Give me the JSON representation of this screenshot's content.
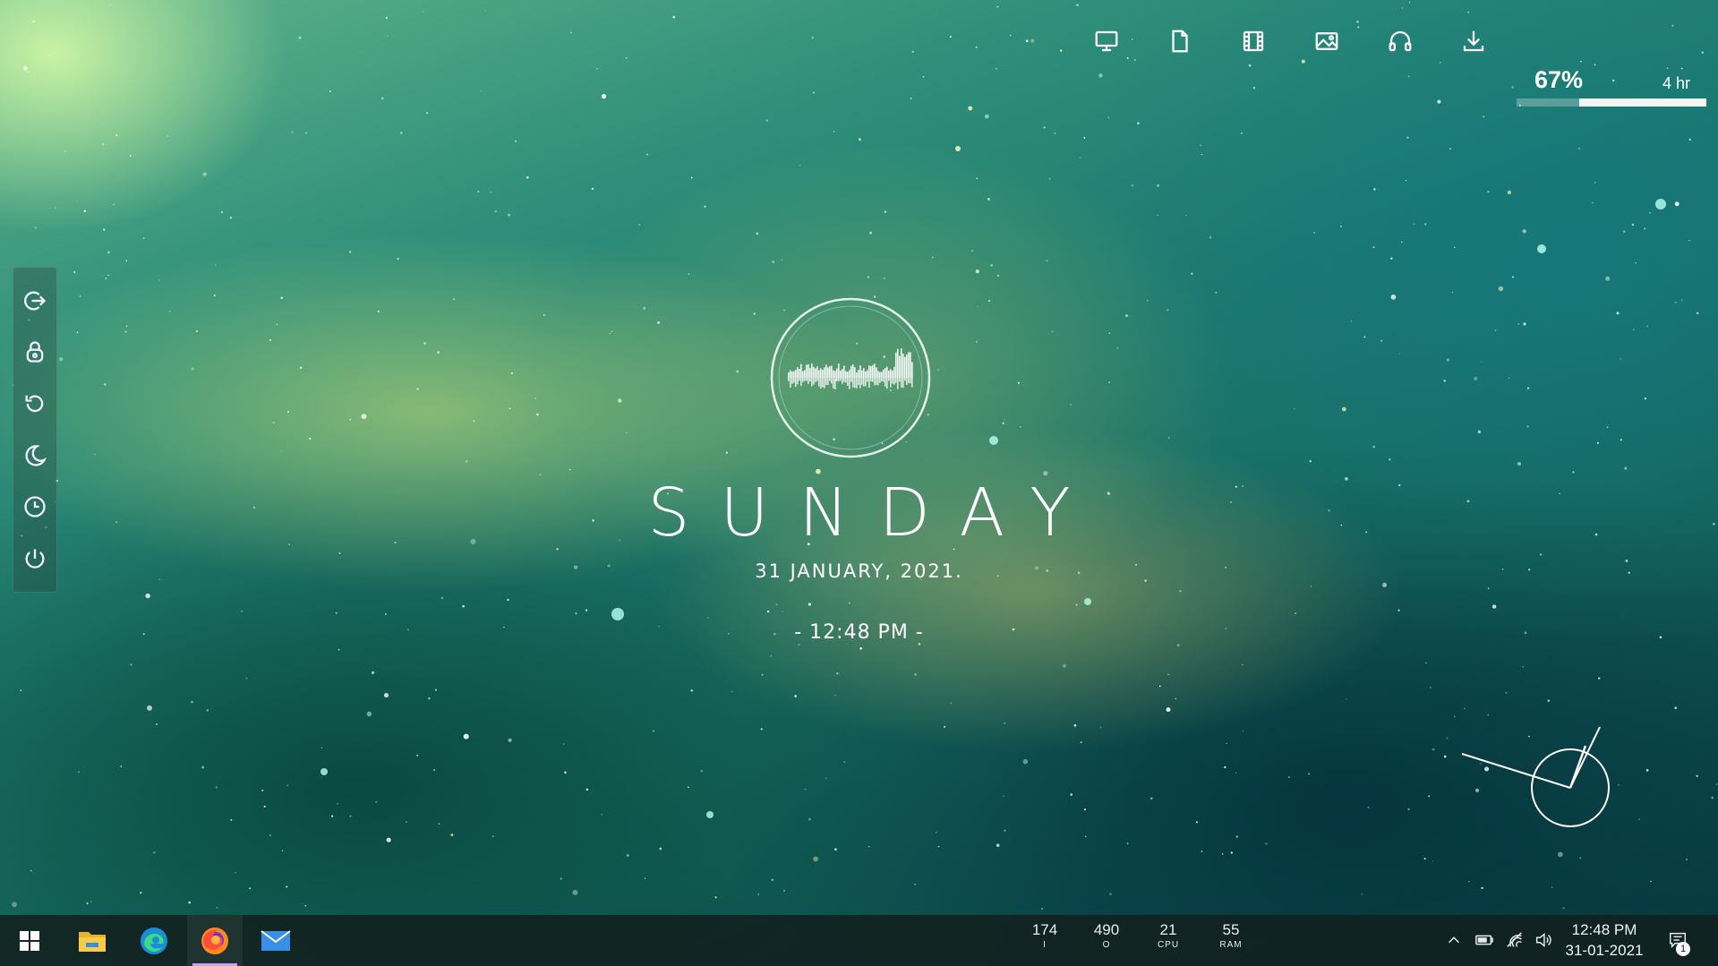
{
  "top_icons": [
    {
      "name": "monitor-icon"
    },
    {
      "name": "document-icon"
    },
    {
      "name": "film-icon"
    },
    {
      "name": "image-icon"
    },
    {
      "name": "headphones-icon"
    },
    {
      "name": "download-icon"
    }
  ],
  "battery": {
    "percent_text": "67%",
    "time_text": "4 hr",
    "level": 0.67
  },
  "power_panel": [
    {
      "name": "sign-out-icon"
    },
    {
      "name": "lock-icon"
    },
    {
      "name": "restart-icon"
    },
    {
      "name": "sleep-icon"
    },
    {
      "name": "hibernate-clock-icon"
    },
    {
      "name": "power-icon"
    }
  ],
  "center": {
    "day": "SUNDAY",
    "date": "31 JANUARY, 2021.",
    "time": "- 12:48 PM -"
  },
  "taskbar": {
    "apps": [
      {
        "name": "start-button"
      },
      {
        "name": "file-explorer-icon"
      },
      {
        "name": "edge-icon"
      },
      {
        "name": "firefox-icon"
      },
      {
        "name": "mail-icon"
      }
    ],
    "stats": [
      {
        "value": "174",
        "label": "I"
      },
      {
        "value": "490",
        "label": "O"
      },
      {
        "value": "21",
        "label": "CPU"
      },
      {
        "value": "55",
        "label": "RAM"
      }
    ],
    "tray": {
      "time": "12:48 PM",
      "date": "31-01-2021",
      "notification_count": "1"
    }
  },
  "colors": {
    "accent_indicator": "#c7a2f3",
    "taskbar_bg": "#12201e"
  }
}
